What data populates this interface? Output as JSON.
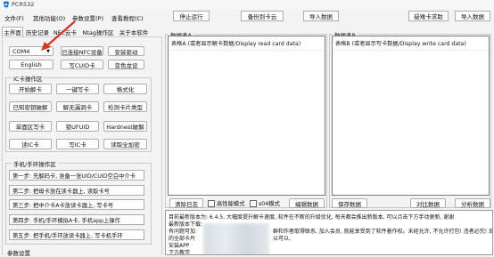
{
  "app": {
    "title": "PCR532"
  },
  "menu": [
    "文件(F)",
    "其他功能(O)",
    "参数设置(P)",
    "查看教程(C)"
  ],
  "toolbar": {
    "stop": "停止运行",
    "backup": "备份到卡云",
    "import_data": "导入数据",
    "scan_tips": "疑难卡求助",
    "import": "导入数据"
  },
  "tabs": [
    "主界面",
    "历史记录",
    "NFC云卡",
    "Ntag操作区",
    "关于本软件"
  ],
  "com": {
    "port": "COM4",
    "connected": "已连接NFC设备",
    "install_driver": "安装驱动",
    "language": "English",
    "write_cuid": "写CUID卡",
    "color_theme": "变色龙设"
  },
  "ic_group": {
    "title": "IC卡操作区",
    "buttons": [
      "开始解卡",
      "一键写卡",
      "格式化",
      "已知密钥破解",
      "解无漏洞卡",
      "检测卡片类型",
      "单面区写卡",
      "锁UFUID",
      "Hardnest破解",
      "读IC卡",
      "写IC卡",
      "读取全加密"
    ]
  },
  "phone_group": {
    "title": "手机/手环操作区",
    "steps": [
      "第一步: 先解码卡, 准备一张UID/CUID空白中介卡",
      "第二步: 把母卡放在读卡器上, 读取卡号",
      "第三步: 把中介卡A卡放读卡器上, 写卡号",
      "第四步: 手机/手环模拟A卡, 手机app上操作",
      "第五步: 把手机/手环放读卡器上, 写卡机手环"
    ]
  },
  "params": {
    "title": "参数设置"
  },
  "panel_a": {
    "title": "数据表A",
    "header": "表格A (或者显示解卡数据/Display read card data)",
    "buttons": {
      "log": "清除日志",
      "hide_hex": "高性能模式",
      "hex_mode": "s04模式",
      "edit": "编辑数据"
    }
  },
  "panel_b": {
    "title": "数据表B",
    "header": "表格B (或者显示写卡数据/Display write card data)",
    "buttons": {
      "save": "保存数据",
      "compare": "对比数据",
      "analyze": "分析数据"
    }
  },
  "log": {
    "lines": [
      "目前最新版本为: 6.4.5, 大幅度提升解卡速度, 软件在不断的升级优化, 每天都会推出新版本, 可以点击下方手动更新, 谢谢",
      "最新版本下载:",
      "有问题可加",
      "的全部卡片",
      "安装APP",
      "下方教学"
    ],
    "partial": {
      "l3": "群和作者取得联系, 加入会员, 就能享受到了软件着作权。未经允许, 不允许打包! 违者必究! 现已",
      "l4": "以可以,"
    }
  },
  "colors": {
    "accent": "#0078d7",
    "arrow": "#e03020",
    "window_bg": "#f3f3f3"
  }
}
